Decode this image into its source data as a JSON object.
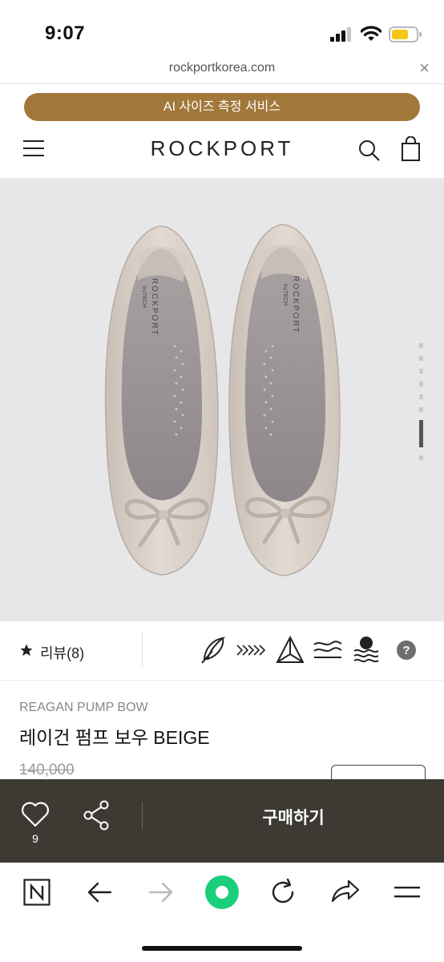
{
  "status_bar": {
    "time": "9:07"
  },
  "browser": {
    "url": "rockportkorea.com",
    "close": "×"
  },
  "banner": {
    "label": "AI 사이즈 측정 서비스"
  },
  "header": {
    "logo": "ROCKPORT"
  },
  "hero": {
    "insole_brand": "ROCKPORT",
    "insole_sub": "truTECH",
    "carousel_count": 8,
    "carousel_active": 7
  },
  "reviews": {
    "label": "리뷰(8)"
  },
  "product": {
    "name_en": "REAGAN PUMP BOW",
    "name_ko": "레이건 펌프 보우 BEIGE",
    "price": "140,000"
  },
  "buy_bar": {
    "like_count": "9",
    "buy_label": "구매하기"
  },
  "colors": {
    "accent": "#a2783a",
    "buy_bar": "#3c3a33",
    "hero_bg": "#e7e7e9",
    "green": "#19cf7c"
  }
}
